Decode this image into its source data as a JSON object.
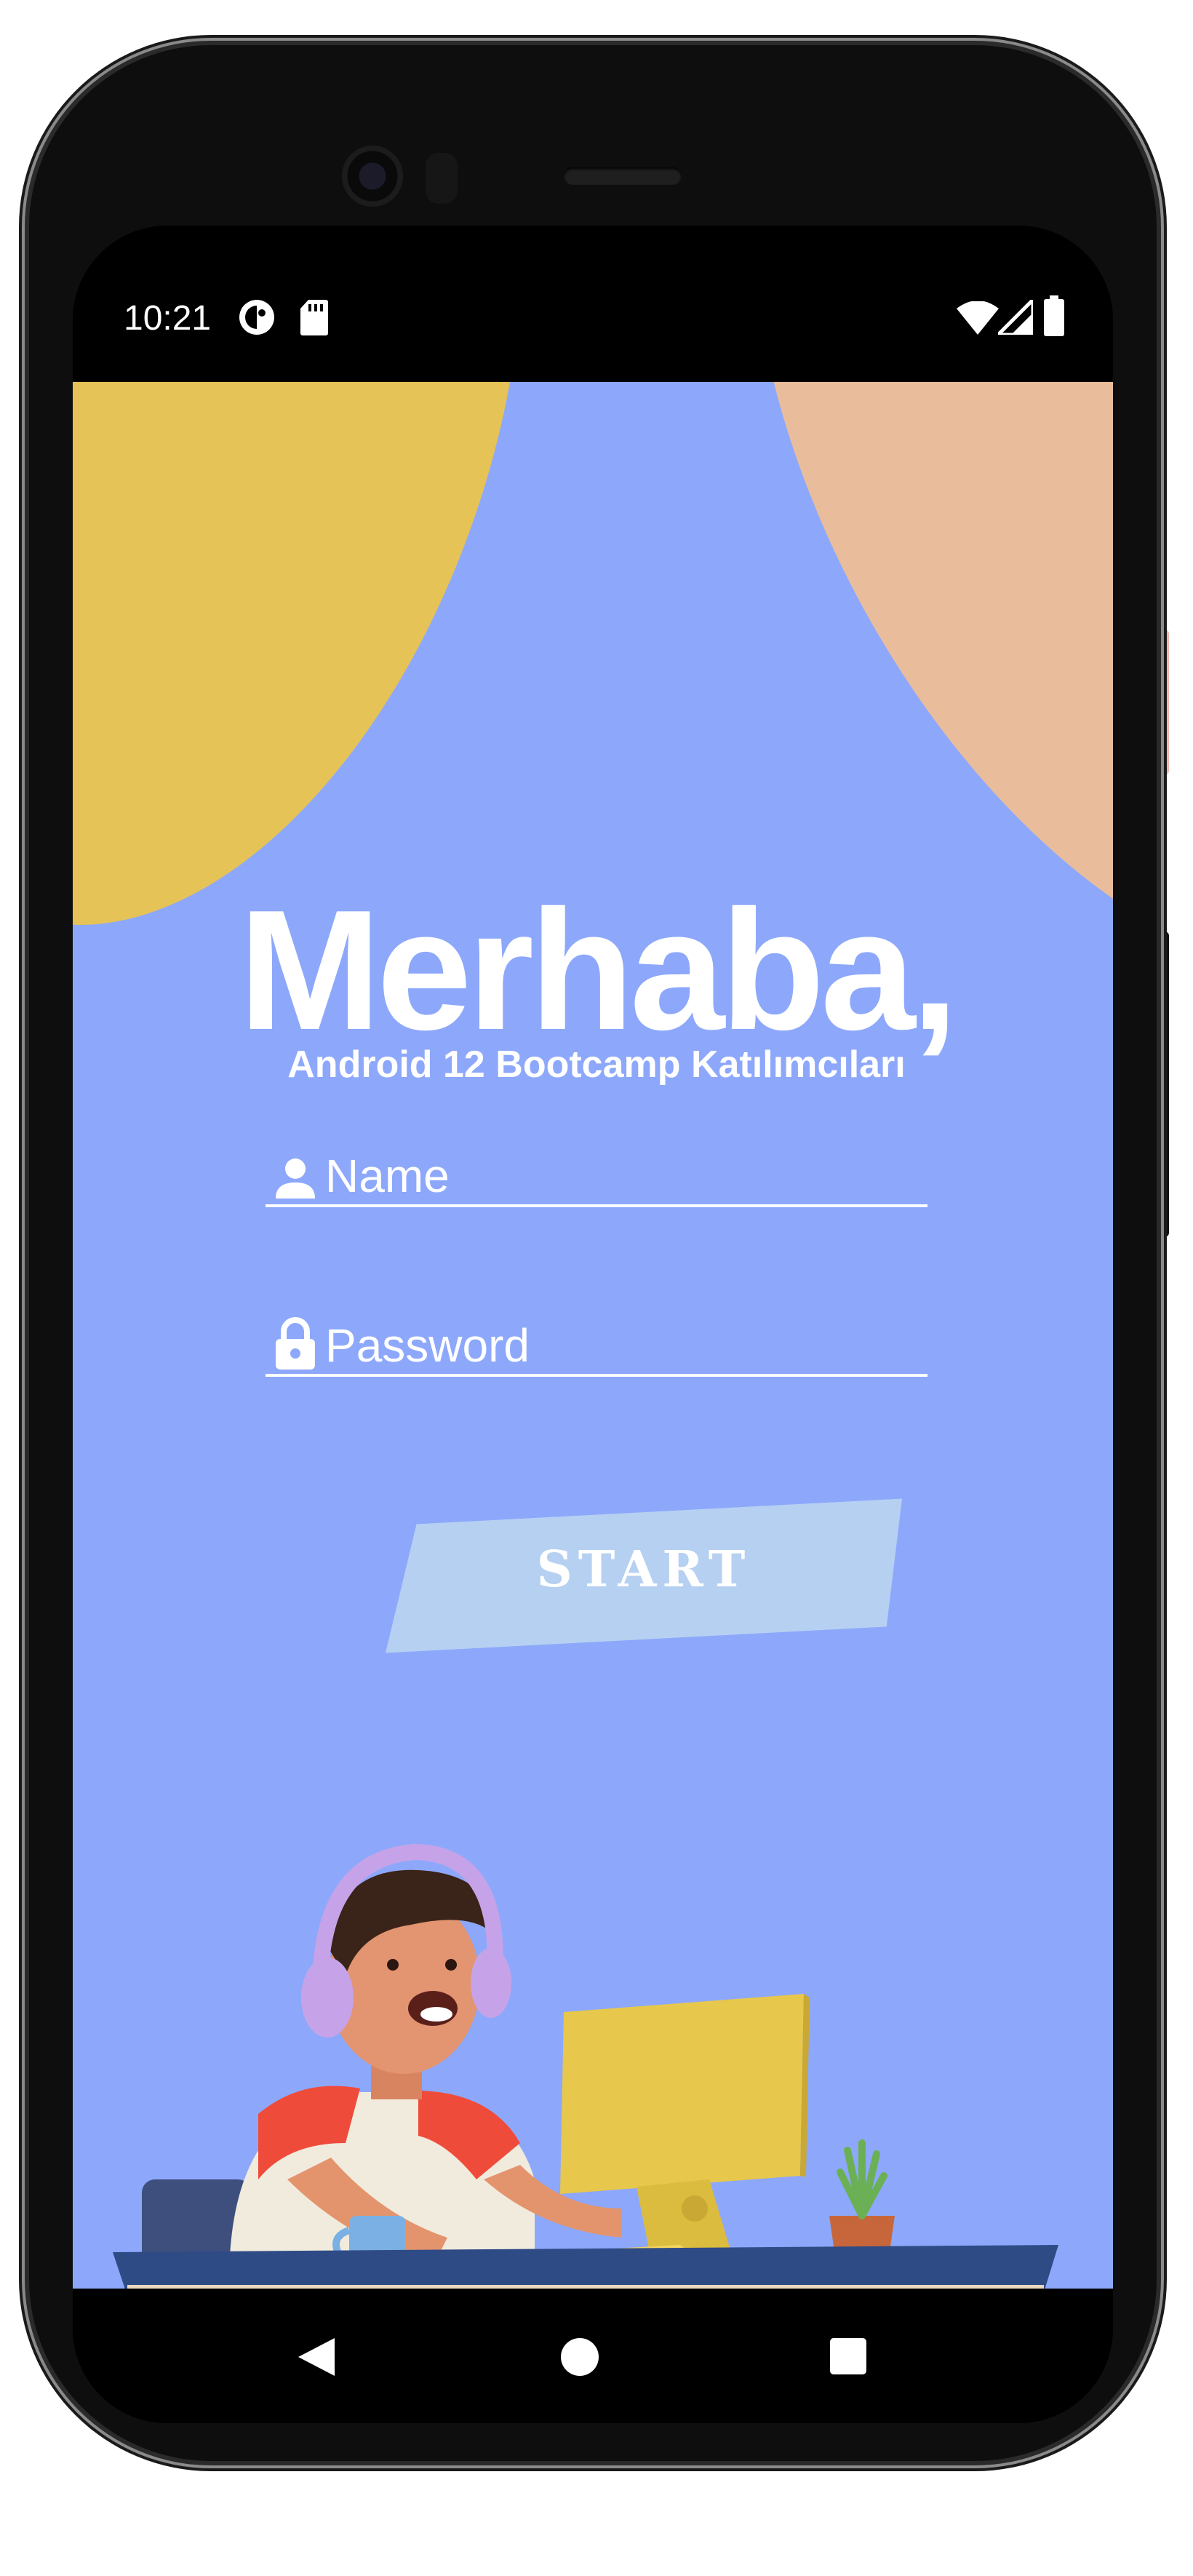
{
  "status_bar": {
    "time": "10:21",
    "left_icons": [
      "app-indicator-icon",
      "sd-card-icon"
    ],
    "right_icons": [
      "wifi-icon",
      "signal-icon",
      "battery-icon"
    ]
  },
  "header": {
    "greeting": "Merhaba,",
    "subtitle": "Android 12 Bootcamp Katılımcıları"
  },
  "form": {
    "name_placeholder": "Name",
    "password_placeholder": "Password",
    "start_label": "START"
  },
  "illustration": {
    "description_icon": "developer-at-desk-illustration"
  },
  "nav_bar": {
    "buttons": [
      "back-icon",
      "home-icon",
      "recents-icon"
    ]
  },
  "colors": {
    "background": "#8da8fb",
    "blob_yellow": "#e6c357",
    "blob_peach": "#e9bd9c",
    "button": "#b6d0f2",
    "text": "#ffffff"
  }
}
